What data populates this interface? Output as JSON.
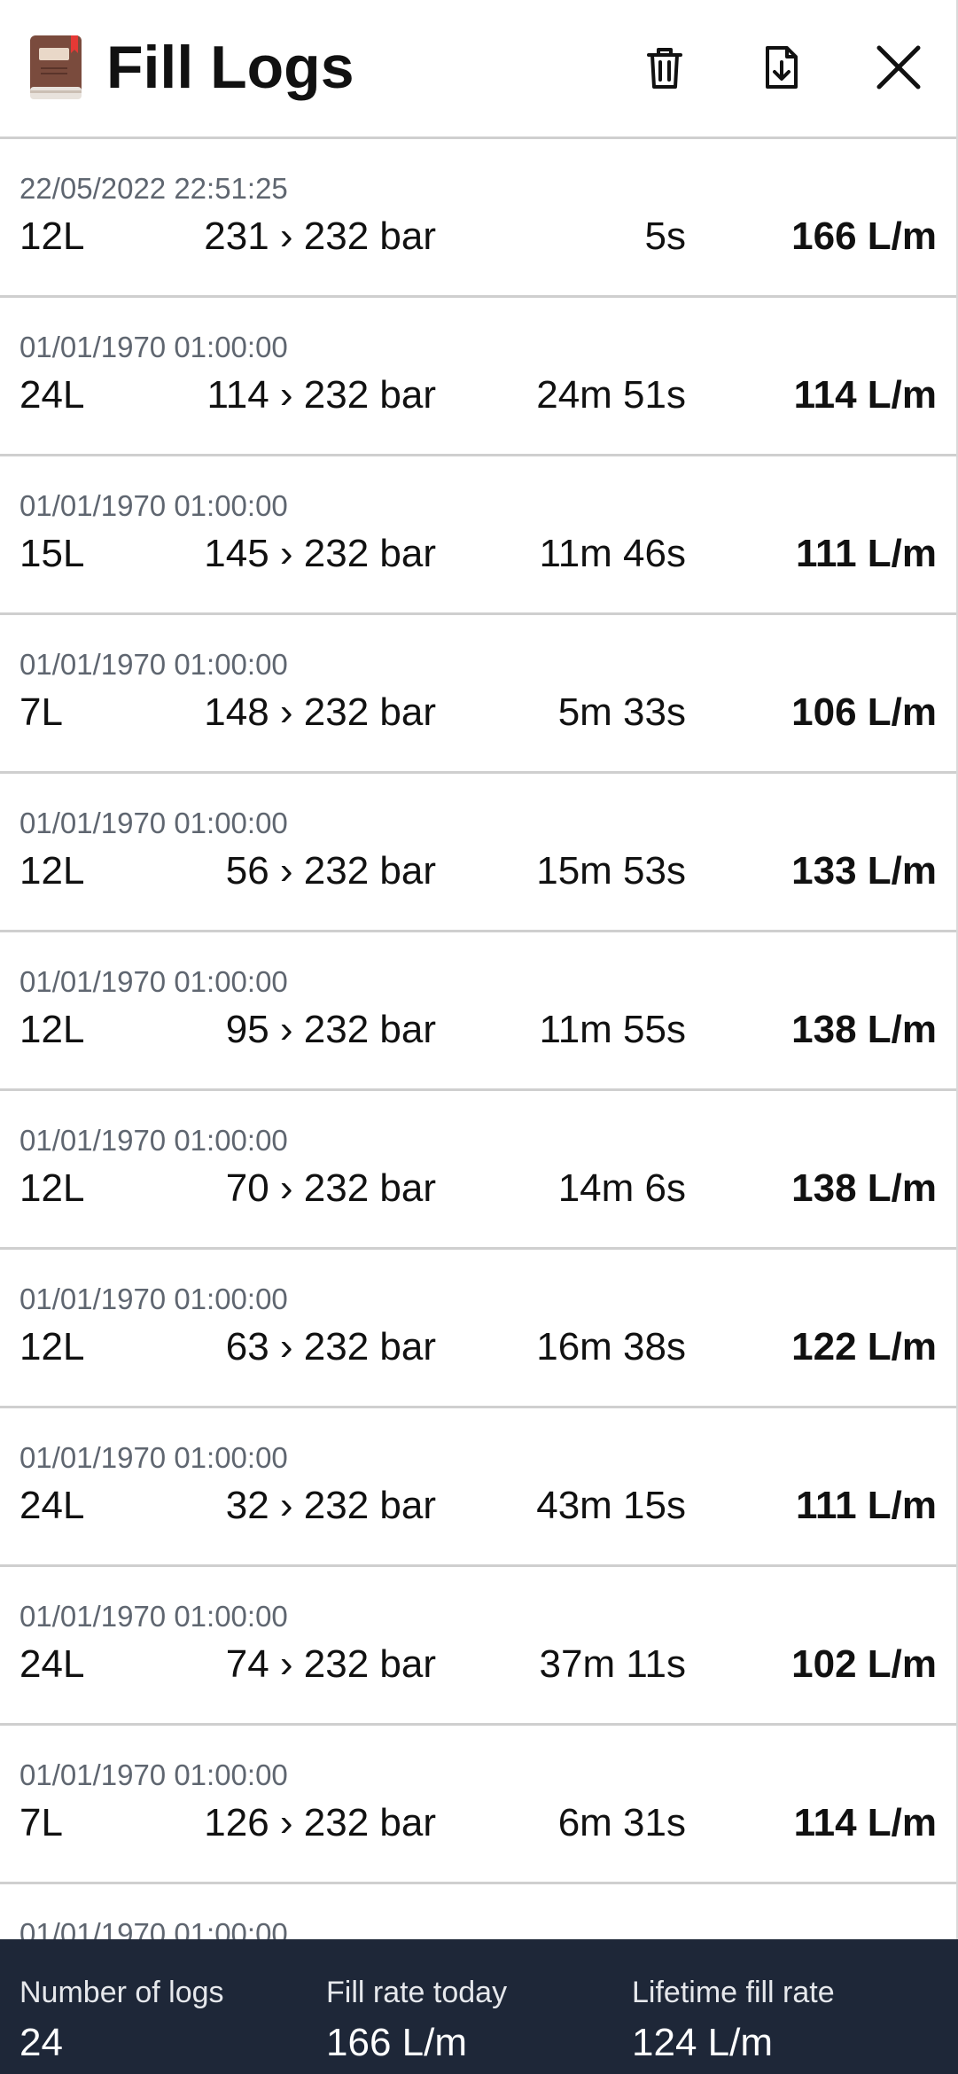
{
  "header": {
    "title": "Fill Logs",
    "icons": {
      "logo": "book-icon",
      "delete": "trash-icon",
      "export": "file-download-icon",
      "close": "close-icon"
    }
  },
  "logs": [
    {
      "date": "22/05/2022 22:51:25",
      "volume": "12L",
      "pressure": "231 › 232 bar",
      "duration": "5s",
      "rate": "166 L/m"
    },
    {
      "date": "01/01/1970 01:00:00",
      "volume": "24L",
      "pressure": "114 › 232 bar",
      "duration": "24m 51s",
      "rate": "114 L/m"
    },
    {
      "date": "01/01/1970 01:00:00",
      "volume": "15L",
      "pressure": "145 › 232 bar",
      "duration": "11m 46s",
      "rate": "111 L/m"
    },
    {
      "date": "01/01/1970 01:00:00",
      "volume": "7L",
      "pressure": "148 › 232 bar",
      "duration": "5m 33s",
      "rate": "106 L/m"
    },
    {
      "date": "01/01/1970 01:00:00",
      "volume": "12L",
      "pressure": "56 › 232 bar",
      "duration": "15m 53s",
      "rate": "133 L/m"
    },
    {
      "date": "01/01/1970 01:00:00",
      "volume": "12L",
      "pressure": "95 › 232 bar",
      "duration": "11m 55s",
      "rate": "138 L/m"
    },
    {
      "date": "01/01/1970 01:00:00",
      "volume": "12L",
      "pressure": "70 › 232 bar",
      "duration": "14m 6s",
      "rate": "138 L/m"
    },
    {
      "date": "01/01/1970 01:00:00",
      "volume": "12L",
      "pressure": "63 › 232 bar",
      "duration": "16m 38s",
      "rate": "122 L/m"
    },
    {
      "date": "01/01/1970 01:00:00",
      "volume": "24L",
      "pressure": "32 › 232 bar",
      "duration": "43m 15s",
      "rate": "111 L/m"
    },
    {
      "date": "01/01/1970 01:00:00",
      "volume": "24L",
      "pressure": "74 › 232 bar",
      "duration": "37m 11s",
      "rate": "102 L/m"
    },
    {
      "date": "01/01/1970 01:00:00",
      "volume": "7L",
      "pressure": "126 › 232 bar",
      "duration": "6m 31s",
      "rate": "114 L/m"
    },
    {
      "date": "01/01/1970 01:00:00",
      "volume": "",
      "pressure": "",
      "duration": "",
      "rate": ""
    }
  ],
  "footer": {
    "count_label": "Number of logs",
    "count_value": "24",
    "today_label": "Fill rate today",
    "today_value": "166 L/m",
    "lifetime_label": "Lifetime fill rate",
    "lifetime_value": "124 L/m"
  },
  "colors": {
    "footer_bg": "#1e2738",
    "divider": "#cfcfcf",
    "date_text": "#5f6670"
  }
}
